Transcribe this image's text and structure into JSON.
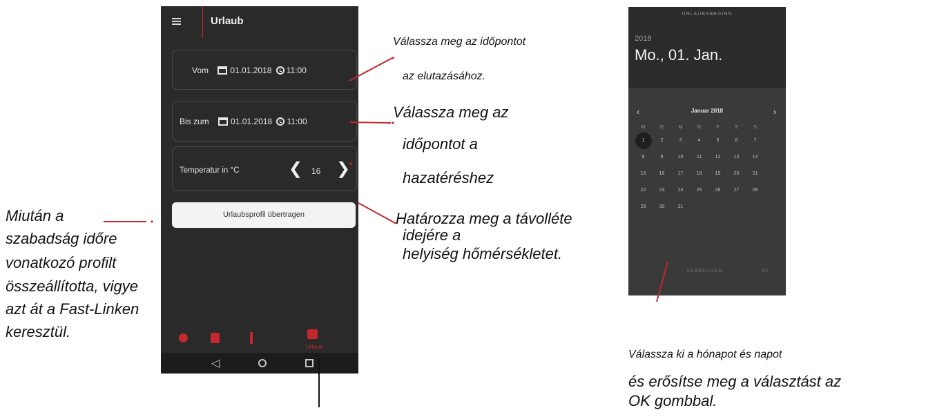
{
  "phone": {
    "title": "Urlaub",
    "from": {
      "label": "Vom",
      "date": "01.01.2018",
      "time": "11:00"
    },
    "to": {
      "label": "Bis zum",
      "date": "01.01.2018",
      "time": "11:00"
    },
    "temperature": {
      "label": "Temperatur in °C",
      "value": "16",
      "dec": "❮",
      "inc": "❯"
    },
    "transfer_button": "Urlaubsprofil übertragen",
    "nav": {
      "active_label": "Urlaub"
    }
  },
  "picker": {
    "top_label": "URLAUBSBEGINN",
    "year": "2018",
    "date": "Mo., 01. Jan.",
    "month": "Januar 2018",
    "prev": "‹",
    "next": "›",
    "weekdays": [
      "M",
      "D",
      "M",
      "D",
      "F",
      "S",
      "S"
    ],
    "weeks": [
      [
        "1",
        "2",
        "3",
        "4",
        "5",
        "6",
        "7"
      ],
      [
        "8",
        "9",
        "10",
        "11",
        "12",
        "13",
        "14"
      ],
      [
        "15",
        "16",
        "17",
        "18",
        "19",
        "20",
        "21"
      ],
      [
        "22",
        "23",
        "24",
        "25",
        "26",
        "27",
        "28"
      ],
      [
        "29",
        "30",
        "31",
        "",
        "",
        "",
        ""
      ]
    ],
    "selected": "1",
    "cancel": "ABBRECHEN",
    "ok": "OK"
  },
  "notes": {
    "n1": "Válassza meg az időpontot",
    "n2": "az elutazásához.",
    "n3": "Válassza meg az",
    "n4": "időpontot  a",
    "n5": "hazatéréshez",
    "n6": "Határozza meg a távolléte",
    "n7": "idejére a",
    "n8": "helyiség hőmérsékletet.",
    "n9": "Miután a",
    "n10": "szabadság időre",
    "n11": "vonatkozó profilt",
    "n12": "összeállította, vigye",
    "n13": "azt át a Fast-Linken",
    "n14": "keresztül.",
    "n15": "Válassza ki a hónapot és napot",
    "n16": "és erősítse meg a választást az",
    "n17": "OK  gombbal."
  },
  "colors": {
    "accent": "#c2282d",
    "phone_bg": "#2a2a2a",
    "picker_bg": "#3a3a3a"
  }
}
